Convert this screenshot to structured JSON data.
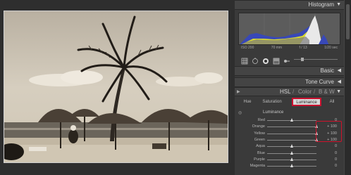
{
  "photo": {
    "description_colors": {
      "sky": "#cfc7b8",
      "sand": "#bfb29b",
      "dark": "#2a241d"
    }
  },
  "panel": {
    "histogram": {
      "title": "Histogram",
      "info": [
        "ISO 200",
        "70 mm",
        "f / 13",
        "1/20 sec"
      ]
    },
    "sections": {
      "basic": "Basic",
      "tone_curve": "Tone Curve"
    },
    "hsl": {
      "header": [
        "HSL",
        "/",
        "Color",
        "/",
        "B & W"
      ],
      "tabs": [
        "Hue",
        "Saturation",
        "Luminance",
        "All"
      ],
      "active_tab": "Luminance",
      "panel_title": "Luminance",
      "sliders": [
        {
          "label": "Red",
          "value": "0",
          "level": 0.0
        },
        {
          "label": "Orange",
          "value": "+ 100",
          "level": 1.0
        },
        {
          "label": "Yellow",
          "value": "+ 100",
          "level": 1.0
        },
        {
          "label": "Green",
          "value": "+ 100",
          "level": 1.0
        },
        {
          "label": "Aqua",
          "value": "0",
          "level": 0.0
        },
        {
          "label": "Blue",
          "value": "0",
          "level": 0.0
        },
        {
          "label": "Purple",
          "value": "0",
          "level": 0.0
        },
        {
          "label": "Magenta",
          "value": "0",
          "level": 0.0
        }
      ]
    },
    "colors": {
      "accent_highlight": "#d0112b",
      "panel_bg": "#3a3a3a"
    }
  }
}
